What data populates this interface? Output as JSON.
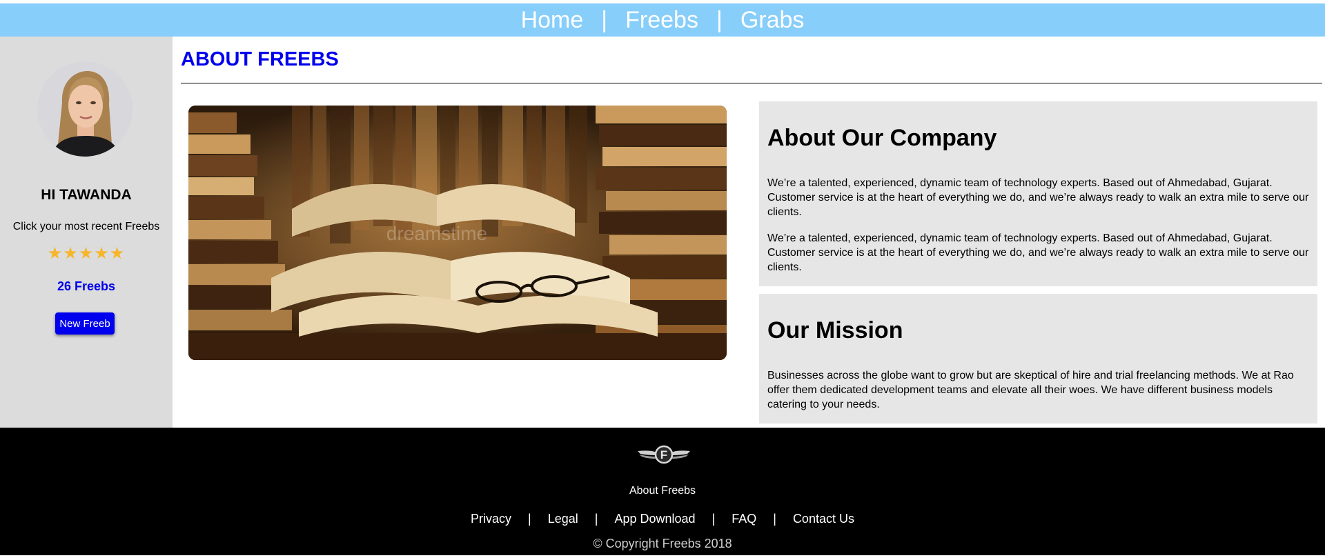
{
  "nav": {
    "items": [
      "Home",
      "Freebs",
      "Grabs"
    ],
    "separator": "|"
  },
  "sidebar": {
    "greeting": "HI TAWANDA",
    "prompt": "Click your most recent Freebs",
    "stars": "★★★★★",
    "rating": 5,
    "count_label": "26 Freebs",
    "new_button": "New Freeb"
  },
  "main": {
    "title": "ABOUT FREEBS",
    "hero_watermark": "dreamstime",
    "about": {
      "heading": "About Our Company",
      "paragraphs": [
        "We’re a talented, experienced, dynamic team of technology experts. Based out of Ahmedabad, Gujarat. Customer service is at the heart of everything we do, and we’re always ready to walk an extra mile to serve our clients.",
        "We’re a talented, experienced, dynamic team of technology experts. Based out of Ahmedabad, Gujarat. Customer service is at the heart of everything we do, and we’re always ready to walk an extra mile to serve our clients."
      ]
    },
    "mission": {
      "heading": "Our Mission",
      "paragraph": "Businesses across the globe want to grow but are skeptical of hire and trial freelancing methods. We at Rao offer them dedicated development teams and elevate all their woes. We have different business models catering to your needs."
    }
  },
  "footer": {
    "logo_letter": "F",
    "about": "About Freebs",
    "links": [
      "Privacy",
      "Legal",
      "App Download",
      "FAQ",
      "Contact Us"
    ],
    "separator": "|",
    "copyright": "© Copyright Freebs 2018"
  },
  "colors": {
    "nav_bg": "#87CEFA",
    "sidebar_bg": "#dcdcdc",
    "accent_blue": "#0000ee",
    "star": "#f7b52a",
    "card_bg": "#e6e6e6",
    "footer_bg": "#000000"
  }
}
